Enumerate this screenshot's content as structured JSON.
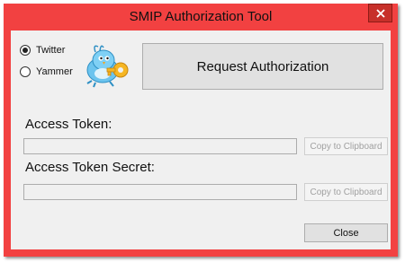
{
  "window": {
    "title": "SMIP Authorization Tool",
    "accent_color": "#f24141",
    "close_icon": "close-x-icon"
  },
  "services": [
    {
      "label": "Twitter",
      "selected": true
    },
    {
      "label": "Yammer",
      "selected": false
    }
  ],
  "mascot_icon": "bird-with-key-icon",
  "request_button": {
    "label": "Request Authorization"
  },
  "access_token": {
    "label": "Access Token:",
    "value": "",
    "copy_label": "Copy to Clipboard"
  },
  "access_token_secret": {
    "label": "Access Token Secret:",
    "value": "",
    "copy_label": "Copy to Clipboard"
  },
  "close_button": {
    "label": "Close"
  }
}
